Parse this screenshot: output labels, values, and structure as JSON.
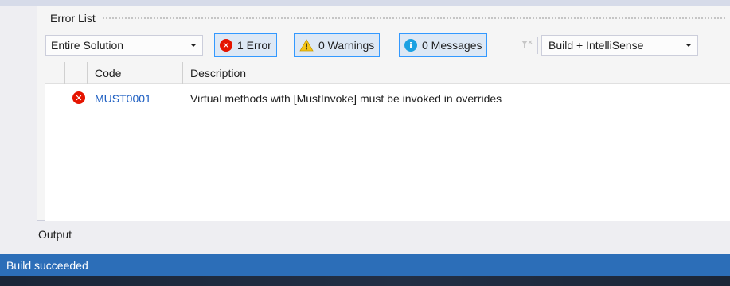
{
  "error_list": {
    "title": "Error List",
    "scope_dropdown": {
      "selected": "Entire Solution"
    },
    "filters": {
      "errors_label": "1 Error",
      "warnings_label": "0 Warnings",
      "messages_label": "0 Messages"
    },
    "build_dropdown": {
      "selected": "Build + IntelliSense"
    },
    "columns": [
      "Code",
      "Description"
    ],
    "rows": [
      {
        "severity": "error",
        "code": "MUST0001",
        "description": "Virtual methods with [MustInvoke] must be invoked in overrides"
      }
    ]
  },
  "output_tab": {
    "label": "Output"
  },
  "status_bar": {
    "text": "Build succeeded"
  },
  "icons": {
    "error": "error-circle-icon",
    "warning": "warning-triangle-icon",
    "info": "info-circle-icon",
    "filter": "funnel-filter-icon"
  },
  "colors": {
    "status_bar": "#2c6eb8",
    "error_icon": "#e51400",
    "info_icon": "#1ba1e2",
    "warning_icon": "#f5c518",
    "link_code": "#1e5fc2",
    "active_filter_border": "#3399ff"
  }
}
